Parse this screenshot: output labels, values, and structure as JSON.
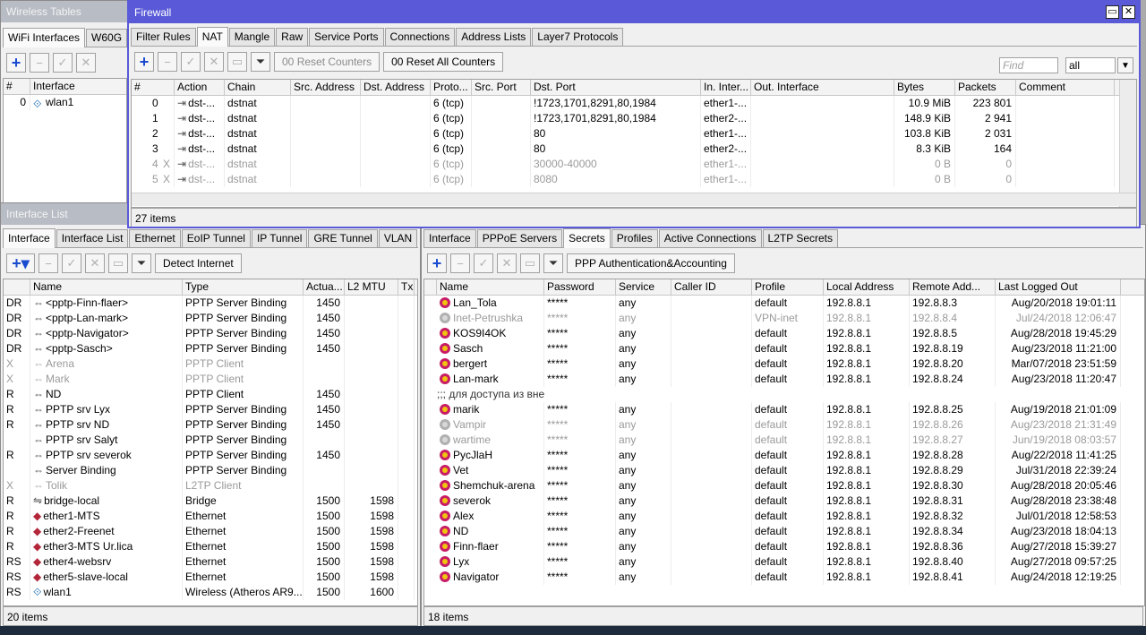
{
  "wireless": {
    "title": "Wireless Tables",
    "tabs": [
      "WiFi Interfaces",
      "W60G"
    ],
    "headers": [
      "#",
      "Interface"
    ],
    "rows": [
      {
        "num": "0",
        "name": "wlan1"
      }
    ]
  },
  "firewall": {
    "title": "Firewall",
    "tabs": [
      "Filter Rules",
      "NAT",
      "Mangle",
      "Raw",
      "Service Ports",
      "Connections",
      "Address Lists",
      "Layer7 Protocols"
    ],
    "selected_tab": "NAT",
    "reset_counters": "Reset Counters",
    "reset_all_counters": "Reset All Counters",
    "counter_glyph": "00",
    "find_placeholder": "Find",
    "filter_value": "all",
    "headers": [
      "#",
      "Action",
      "Chain",
      "Src. Address",
      "Dst. Address",
      "Proto...",
      "Src. Port",
      "Dst. Port",
      "In. Inter...",
      "Out. Interface",
      "Bytes",
      "Packets",
      "Comment"
    ],
    "rows": [
      {
        "num": "0",
        "x": "",
        "action": "dst-...",
        "chain": "dstnat",
        "proto": "6 (tcp)",
        "dport": "!1723,1701,8291,80,1984",
        "inif": "ether1-...",
        "bytes": "10.9 MiB",
        "packets": "223 801",
        "disabled": false
      },
      {
        "num": "1",
        "x": "",
        "action": "dst-...",
        "chain": "dstnat",
        "proto": "6 (tcp)",
        "dport": "!1723,1701,8291,80,1984",
        "inif": "ether2-...",
        "bytes": "148.9 KiB",
        "packets": "2 941",
        "disabled": false
      },
      {
        "num": "2",
        "x": "",
        "action": "dst-...",
        "chain": "dstnat",
        "proto": "6 (tcp)",
        "dport": "80",
        "inif": "ether1-...",
        "bytes": "103.8 KiB",
        "packets": "2 031",
        "disabled": false
      },
      {
        "num": "3",
        "x": "",
        "action": "dst-...",
        "chain": "dstnat",
        "proto": "6 (tcp)",
        "dport": "80",
        "inif": "ether2-...",
        "bytes": "8.3 KiB",
        "packets": "164",
        "disabled": false
      },
      {
        "num": "4",
        "x": "X",
        "action": "dst-...",
        "chain": "dstnat",
        "proto": "6 (tcp)",
        "dport": "30000-40000",
        "inif": "ether1-...",
        "bytes": "0 B",
        "packets": "0",
        "disabled": true
      },
      {
        "num": "5",
        "x": "X",
        "action": "dst-...",
        "chain": "dstnat",
        "proto": "6 (tcp)",
        "dport": "8080",
        "inif": "ether1-...",
        "bytes": "0 B",
        "packets": "0",
        "disabled": true
      }
    ],
    "status": "27 items"
  },
  "iflist": {
    "title": "Interface List",
    "tabs": [
      "Interface",
      "Interface List",
      "Ethernet",
      "EoIP Tunnel",
      "IP Tunnel",
      "GRE Tunnel",
      "VLAN"
    ],
    "selected_tab": "Interface",
    "detect_label": "Detect Internet",
    "headers": [
      "",
      "Name",
      "Type",
      "Actua...",
      "L2 MTU",
      "Tx"
    ],
    "rows": [
      {
        "flag": "DR",
        "name": "<pptp-Finn-flaer>",
        "type": "PPTP Server Binding",
        "mtu": "1450",
        "l2": "",
        "dis": false,
        "icon": "tunnel"
      },
      {
        "flag": "DR",
        "name": "<pptp-Lan-mark>",
        "type": "PPTP Server Binding",
        "mtu": "1450",
        "l2": "",
        "dis": false,
        "icon": "tunnel"
      },
      {
        "flag": "DR",
        "name": "<pptp-Navigator>",
        "type": "PPTP Server Binding",
        "mtu": "1450",
        "l2": "",
        "dis": false,
        "icon": "tunnel"
      },
      {
        "flag": "DR",
        "name": "<pptp-Sasch>",
        "type": "PPTP Server Binding",
        "mtu": "1450",
        "l2": "",
        "dis": false,
        "icon": "tunnel"
      },
      {
        "flag": "X",
        "name": "Arena",
        "type": "PPTP Client",
        "mtu": "",
        "l2": "",
        "dis": true,
        "icon": "tunnel"
      },
      {
        "flag": "X",
        "name": "Mark",
        "type": "PPTP Client",
        "mtu": "",
        "l2": "",
        "dis": true,
        "icon": "tunnel"
      },
      {
        "flag": "R",
        "name": "ND",
        "type": "PPTP Client",
        "mtu": "1450",
        "l2": "",
        "dis": false,
        "icon": "tunnel"
      },
      {
        "flag": "R",
        "name": "PPTP srv Lyx",
        "type": "PPTP Server Binding",
        "mtu": "1450",
        "l2": "",
        "dis": false,
        "icon": "tunnel"
      },
      {
        "flag": "R",
        "name": "PPTP srv ND",
        "type": "PPTP Server Binding",
        "mtu": "1450",
        "l2": "",
        "dis": false,
        "icon": "tunnel"
      },
      {
        "flag": "",
        "name": "PPTP srv Salyt",
        "type": "PPTP Server Binding",
        "mtu": "",
        "l2": "",
        "dis": false,
        "icon": "tunnel"
      },
      {
        "flag": "R",
        "name": "PPTP srv severok",
        "type": "PPTP Server Binding",
        "mtu": "1450",
        "l2": "",
        "dis": false,
        "icon": "tunnel"
      },
      {
        "flag": "",
        "name": "Server Binding",
        "type": "PPTP Server Binding",
        "mtu": "",
        "l2": "",
        "dis": false,
        "icon": "tunnel"
      },
      {
        "flag": "X",
        "name": "Tolik",
        "type": "L2TP Client",
        "mtu": "",
        "l2": "",
        "dis": true,
        "icon": "tunnel"
      },
      {
        "flag": "R",
        "name": "bridge-local",
        "type": "Bridge",
        "mtu": "1500",
        "l2": "1598",
        "dis": false,
        "icon": "bridge"
      },
      {
        "flag": "R",
        "name": "ether1-MTS",
        "type": "Ethernet",
        "mtu": "1500",
        "l2": "1598",
        "dis": false,
        "icon": "ether"
      },
      {
        "flag": "R",
        "name": "ether2-Freenet",
        "type": "Ethernet",
        "mtu": "1500",
        "l2": "1598",
        "dis": false,
        "icon": "ether"
      },
      {
        "flag": "R",
        "name": "ether3-MTS Ur.lica",
        "type": "Ethernet",
        "mtu": "1500",
        "l2": "1598",
        "dis": false,
        "icon": "ether"
      },
      {
        "flag": "RS",
        "name": "ether4-websrv",
        "type": "Ethernet",
        "mtu": "1500",
        "l2": "1598",
        "dis": false,
        "icon": "ether"
      },
      {
        "flag": "RS",
        "name": "ether5-slave-local",
        "type": "Ethernet",
        "mtu": "1500",
        "l2": "1598",
        "dis": false,
        "icon": "ether"
      },
      {
        "flag": "RS",
        "name": "wlan1",
        "type": "Wireless (Atheros AR9...",
        "mtu": "1500",
        "l2": "1600",
        "dis": false,
        "icon": "wlan"
      }
    ],
    "status": "20 items"
  },
  "ppp": {
    "tabs": [
      "Interface",
      "PPPoE Servers",
      "Secrets",
      "Profiles",
      "Active Connections",
      "L2TP Secrets"
    ],
    "selected_tab": "Secrets",
    "auth_label": "PPP Authentication&Accounting",
    "headers": [
      "Name",
      "Password",
      "Service",
      "Caller ID",
      "Profile",
      "Local Address",
      "Remote Add...",
      "Last Logged Out"
    ],
    "rows": [
      {
        "name": "Lan_Tola",
        "pass": "*****",
        "service": "any",
        "profile": "default",
        "local": "192.8.8.1",
        "remote": "192.8.8.3",
        "last": "Aug/20/2018 19:01:11",
        "dis": false
      },
      {
        "name": "Inet-Petrushka",
        "pass": "*****",
        "service": "any",
        "profile": "VPN-inet",
        "local": "192.8.8.1",
        "remote": "192.8.8.4",
        "last": "Jul/24/2018 12:06:47",
        "dis": true
      },
      {
        "name": "KOS9I4OK",
        "pass": "*****",
        "service": "any",
        "profile": "default",
        "local": "192.8.8.1",
        "remote": "192.8.8.5",
        "last": "Aug/28/2018 19:45:29",
        "dis": false
      },
      {
        "name": "Sasch",
        "pass": "*****",
        "service": "any",
        "profile": "default",
        "local": "192.8.8.1",
        "remote": "192.8.8.19",
        "last": "Aug/23/2018 11:21:00",
        "dis": false
      },
      {
        "name": "bergert",
        "pass": "*****",
        "service": "any",
        "profile": "default",
        "local": "192.8.8.1",
        "remote": "192.8.8.20",
        "last": "Mar/07/2018 23:51:59",
        "dis": false
      },
      {
        "name": "Lan-mark",
        "pass": "*****",
        "service": "any",
        "profile": "default",
        "local": "192.8.8.1",
        "remote": "192.8.8.24",
        "last": "Aug/23/2018 11:20:47",
        "dis": false
      },
      {
        "comment": ";;; для доступа из вне"
      },
      {
        "name": "marik",
        "pass": "*****",
        "service": "any",
        "profile": "default",
        "local": "192.8.8.1",
        "remote": "192.8.8.25",
        "last": "Aug/19/2018 21:01:09",
        "dis": false
      },
      {
        "name": "Vampir",
        "pass": "*****",
        "service": "any",
        "profile": "default",
        "local": "192.8.8.1",
        "remote": "192.8.8.26",
        "last": "Aug/23/2018 21:31:49",
        "dis": true
      },
      {
        "name": "wartime",
        "pass": "*****",
        "service": "any",
        "profile": "default",
        "local": "192.8.8.1",
        "remote": "192.8.8.27",
        "last": "Jun/19/2018 08:03:57",
        "dis": true
      },
      {
        "name": "PycJlaH",
        "pass": "*****",
        "service": "any",
        "profile": "default",
        "local": "192.8.8.1",
        "remote": "192.8.8.28",
        "last": "Aug/22/2018 11:41:25",
        "dis": false
      },
      {
        "name": "Vet",
        "pass": "*****",
        "service": "any",
        "profile": "default",
        "local": "192.8.8.1",
        "remote": "192.8.8.29",
        "last": "Jul/31/2018 22:39:24",
        "dis": false
      },
      {
        "name": "Shemchuk-arena",
        "pass": "*****",
        "service": "any",
        "profile": "default",
        "local": "192.8.8.1",
        "remote": "192.8.8.30",
        "last": "Aug/28/2018 20:05:46",
        "dis": false
      },
      {
        "name": "severok",
        "pass": "*****",
        "service": "any",
        "profile": "default",
        "local": "192.8.8.1",
        "remote": "192.8.8.31",
        "last": "Aug/28/2018 23:38:48",
        "dis": false
      },
      {
        "name": "Alex",
        "pass": "*****",
        "service": "any",
        "profile": "default",
        "local": "192.8.8.1",
        "remote": "192.8.8.32",
        "last": "Jul/01/2018 12:58:53",
        "dis": false
      },
      {
        "name": "ND",
        "pass": "*****",
        "service": "any",
        "profile": "default",
        "local": "192.8.8.1",
        "remote": "192.8.8.34",
        "last": "Aug/23/2018 18:04:13",
        "dis": false
      },
      {
        "name": "Finn-flaer",
        "pass": "*****",
        "service": "any",
        "profile": "default",
        "local": "192.8.8.1",
        "remote": "192.8.8.36",
        "last": "Aug/27/2018 15:39:27",
        "dis": false
      },
      {
        "name": "Lyx",
        "pass": "*****",
        "service": "any",
        "profile": "default",
        "local": "192.8.8.1",
        "remote": "192.8.8.40",
        "last": "Aug/27/2018 09:57:25",
        "dis": false
      },
      {
        "name": "Navigator",
        "pass": "*****",
        "service": "any",
        "profile": "default",
        "local": "192.8.8.1",
        "remote": "192.8.8.41",
        "last": "Aug/24/2018 12:19:25",
        "dis": false
      }
    ],
    "status": "18 items"
  },
  "colors": {
    "active_title": "#5a5ad8",
    "inactive_title": "#b8bcc4",
    "user_icon": "#c81d66",
    "add_button": "#1a4bd0"
  }
}
